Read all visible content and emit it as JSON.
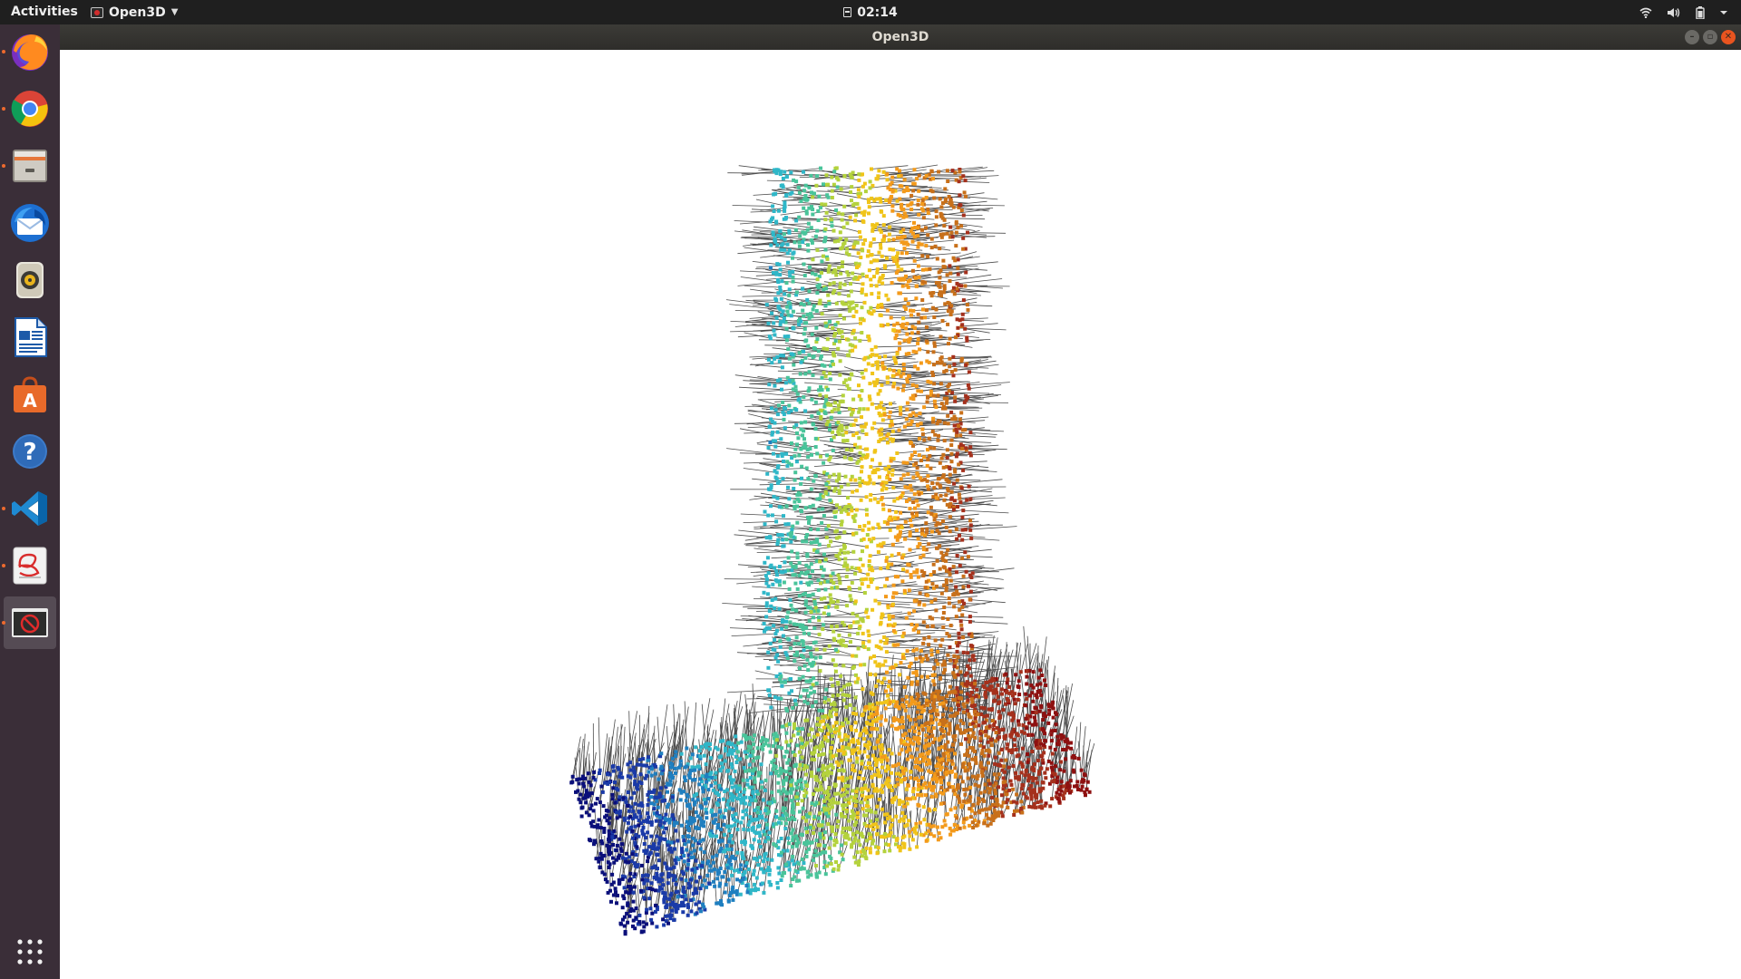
{
  "topbar": {
    "activities_label": "Activities",
    "app_menu_label": "Open3D",
    "clock": "02:14",
    "status_icons": [
      "wifi-icon",
      "volume-icon",
      "battery-icon",
      "system-menu-caret-icon"
    ]
  },
  "dock": {
    "items": [
      {
        "name": "firefox",
        "running": true
      },
      {
        "name": "chrome",
        "running": true
      },
      {
        "name": "files",
        "running": true
      },
      {
        "name": "thunderbird",
        "running": false
      },
      {
        "name": "rhythmbox",
        "running": false
      },
      {
        "name": "libreoffice-writer",
        "running": false
      },
      {
        "name": "ubuntu-software",
        "running": false
      },
      {
        "name": "help",
        "running": false
      },
      {
        "name": "vscode",
        "running": true
      },
      {
        "name": "document-viewer",
        "running": true
      },
      {
        "name": "open3d",
        "running": true,
        "active": true
      }
    ],
    "show_apps_icon": "grid-icon"
  },
  "window": {
    "title": "Open3D"
  },
  "viewer": {
    "background": "#ffffff",
    "palette": [
      "#0a0f7a",
      "#1a3aa8",
      "#1f7fc0",
      "#2fb7c8",
      "#49c49a",
      "#b4d23c",
      "#f0c419",
      "#f39a1b",
      "#c8701a",
      "#a5301c",
      "#8e1010"
    ],
    "normal_line_color": "#111111"
  }
}
